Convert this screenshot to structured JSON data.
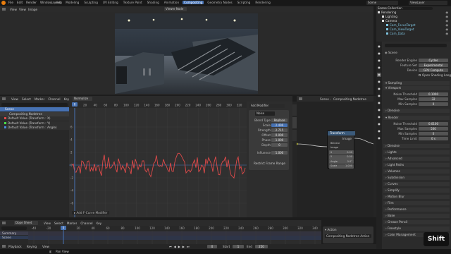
{
  "topbar": {
    "menus": [
      "File",
      "Edit",
      "Render",
      "Window",
      "Help"
    ],
    "workspaces": [
      "Layout",
      "Modeling",
      "Sculpting",
      "UV Editing",
      "Texture Paint",
      "Shading",
      "Animation",
      "Compositing",
      "Geometry Nodes",
      "Scripting",
      "Rendering"
    ],
    "active_workspace": "Compositing",
    "scene_name": "Scene",
    "view_layer": "ViewLayer"
  },
  "viewport": {
    "menus": [
      "View",
      "View",
      "Image"
    ],
    "mode": "Viewer Node"
  },
  "outliner": {
    "title": "Scene Collection",
    "items": [
      "Rendering",
      "Lighting",
      "Camera",
      "Cam_FocusTarget",
      "Cam_ViewTarget",
      "Cam_Data"
    ]
  },
  "graph": {
    "menus": [
      "View",
      "Select",
      "Marker",
      "Channel",
      "Key"
    ],
    "normalize": "Normalize",
    "channels": [
      "Scene",
      "Compositing Nodetree",
      "Default Value (Transform : X)",
      "Default Value (Transform : Y)",
      "Default Value (Transform : Angle)"
    ],
    "frame_ticks": [
      "0",
      "20",
      "40",
      "60",
      "80",
      "100",
      "120",
      "140",
      "160",
      "180",
      "200",
      "220",
      "240",
      "260",
      "280",
      "300",
      "320",
      "340"
    ],
    "value_ticks": [
      "6",
      "4",
      "2",
      "0",
      "-2",
      "-4",
      "-6"
    ],
    "last_op": "Add F-Curve Modifier",
    "current_frame": "0"
  },
  "modifier": {
    "add": "Add Modifier",
    "name": "Noise",
    "rows": [
      {
        "label": "Blend Type",
        "value": "Replace"
      },
      {
        "label": "Scale",
        "value": "2.496"
      },
      {
        "label": "Strength",
        "value": "2.715"
      },
      {
        "label": "Offset",
        "value": "0.000"
      },
      {
        "label": "Phase",
        "value": "1.000"
      },
      {
        "label": "Depth",
        "value": "0"
      },
      {
        "label": "Influence",
        "value": "1.000"
      }
    ],
    "restrict": "Restrict Frame Range",
    "tabs": [
      "F-Curve",
      "Modifiers",
      "View"
    ]
  },
  "nodes": {
    "breadcrumb": [
      "Scene",
      "Compositing Nodetree"
    ],
    "node_title": "Transform",
    "node_out": "Image",
    "node_fields": [
      "Bilinear",
      "Image",
      "X",
      "Y",
      "Angle",
      "Scale"
    ],
    "node_values": [
      "",
      "",
      "0.00",
      "0.00",
      "0.0°",
      "1.000"
    ],
    "side_tabs": [
      "Node",
      "Tool",
      "View",
      "Options"
    ]
  },
  "properties": {
    "scene": "Scene",
    "render_engine": {
      "label": "Render Engine",
      "value": "Cycles"
    },
    "feature_set": {
      "label": "Feature Set",
      "value": "Experimental"
    },
    "device": {
      "label": "Device",
      "value": "GPU Compute"
    },
    "osl": "Open Shading Language",
    "sampling": "Sampling",
    "viewport": "Viewport",
    "v_noise": {
      "label": "Noise Threshold",
      "value": "0.1000"
    },
    "v_max": {
      "label": "Max Samples",
      "value": "32"
    },
    "v_min": {
      "label": "Min Samples",
      "value": "0"
    },
    "denoise": "Denoise",
    "render": "Render",
    "r_noise": {
      "label": "Noise Threshold",
      "value": "0.0100"
    },
    "r_max": {
      "label": "Max Samples",
      "value": "500"
    },
    "r_min": {
      "label": "Min Samples",
      "value": "0"
    },
    "r_time": {
      "label": "Time Limit",
      "value": "0 s"
    },
    "sections": [
      "Denoise",
      "Lights",
      "Advanced",
      "Light Paths",
      "Volumes",
      "Subdivision",
      "Curves",
      "Simplify",
      "Motion Blur",
      "Film",
      "Performance",
      "Bake",
      "Grease Pencil",
      "Freestyle",
      "Color Management"
    ]
  },
  "dopesheet": {
    "mode": "Dope Sheet",
    "menus": [
      "View",
      "Select",
      "Marker",
      "Channel",
      "Key"
    ],
    "rows": [
      "Summary",
      "Scene"
    ],
    "ticks": [
      "-40",
      "-20",
      "0",
      "20",
      "40",
      "60",
      "80",
      "100",
      "120",
      "140",
      "160",
      "180",
      "200",
      "220",
      "240",
      "260",
      "280",
      "300",
      "320",
      "340"
    ],
    "playback": "Playback",
    "keying": "Keying",
    "view_menu": "View",
    "frame": "0",
    "start_label": "Start",
    "start": "1",
    "end_label": "End",
    "end": "250"
  },
  "action": {
    "title": "Action",
    "item": "Compositing Nodetree Action"
  },
  "statusbar": {
    "text": "Pan View"
  },
  "key_overlay": "Shift",
  "colors": {
    "accent": "#4772b3",
    "curve": "#e04a4a",
    "active_ws": "#4772b3",
    "playhead": "#4772b3"
  }
}
